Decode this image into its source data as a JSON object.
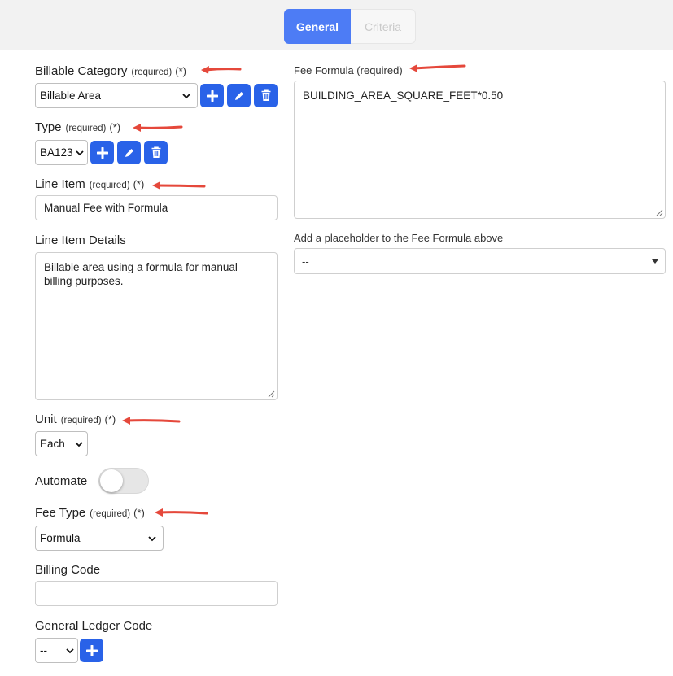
{
  "tabs": {
    "general": "General",
    "criteria": "Criteria"
  },
  "required_text": "(required)",
  "star_text": "(*)",
  "billable_category": {
    "label": "Billable Category",
    "value": "Billable Area"
  },
  "type": {
    "label": "Type",
    "value": "BA123"
  },
  "line_item": {
    "label": "Line Item",
    "value": "Manual Fee with Formula"
  },
  "line_item_details": {
    "label": "Line Item Details",
    "value": "Billable area using a formula for manual billing purposes."
  },
  "unit": {
    "label": "Unit",
    "value": "Each"
  },
  "automate": {
    "label": "Automate",
    "enabled": false
  },
  "fee_type": {
    "label": "Fee Type",
    "value": "Formula"
  },
  "billing_code": {
    "label": "Billing Code",
    "value": ""
  },
  "general_ledger_code": {
    "label": "General Ledger Code",
    "value": "--"
  },
  "fee_formula": {
    "label": "Fee Formula (required)",
    "value": "BUILDING_AREA_SQUARE_FEET*0.50"
  },
  "placeholder": {
    "label": "Add a placeholder to the Fee Formula above",
    "value": "--"
  },
  "colors": {
    "accent": "#4d7cf5",
    "button": "#2962e8",
    "annotation_arrow": "#e5483b"
  },
  "icons": [
    "plus-icon",
    "pencil-icon",
    "trash-icon",
    "chevron-down-icon",
    "annotation-arrow"
  ]
}
